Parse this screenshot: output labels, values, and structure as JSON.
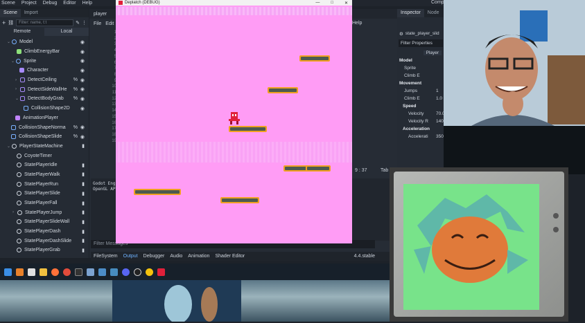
{
  "menu": {
    "items": [
      "Scene",
      "Project",
      "Debug",
      "Editor",
      "Help"
    ]
  },
  "scene_dock": {
    "tabs": [
      "Scene",
      "Import"
    ],
    "filter_placeholder": "Filter: name, t:t",
    "remote_label": "Remote",
    "local_label": "Local",
    "nodes": [
      {
        "label": "Model",
        "color": "#7ab0ff"
      },
      {
        "label": "ClimbEnergyBar",
        "color": "#8de07a"
      },
      {
        "label": "Sprite",
        "color": "#7ab0ff"
      },
      {
        "label": "Character",
        "color": "#a78bfa"
      },
      {
        "label": "DetectCeiling",
        "color": "#a78bfa"
      },
      {
        "label": "DetectSideWallHe",
        "color": "#a78bfa"
      },
      {
        "label": "DetectBodyGrab",
        "color": "#a78bfa"
      },
      {
        "label": "CollisionShape2D",
        "color": "#7ab0ff"
      },
      {
        "label": "AnimationPlayer",
        "color": "#c084fc"
      },
      {
        "label": "CollisionShapeNorma",
        "color": "#7ab0ff"
      },
      {
        "label": "CollisionShapeSlide",
        "color": "#7ab0ff"
      },
      {
        "label": "PlayerStateMachine",
        "color": "#cdd3dc"
      },
      {
        "label": "CoyoteTimer",
        "color": "#cdd3dc"
      },
      {
        "label": "StatePlayerIdle",
        "color": "#cdd3dc"
      },
      {
        "label": "StatePlayerWalk",
        "color": "#cdd3dc"
      },
      {
        "label": "StatePlayerRun",
        "color": "#cdd3dc"
      },
      {
        "label": "StatePlayerSlide",
        "color": "#cdd3dc"
      },
      {
        "label": "StatePlayerFall",
        "color": "#cdd3dc"
      },
      {
        "label": "StatePlayerJump",
        "color": "#cdd3dc"
      },
      {
        "label": "StatePlayerSlideWall",
        "color": "#cdd3dc"
      },
      {
        "label": "StatePlayerDash",
        "color": "#cdd3dc"
      },
      {
        "label": "StatePlayerDashSlide",
        "color": "#cdd3dc"
      },
      {
        "label": "StatePlayerGrab",
        "color": "#cdd3dc"
      }
    ]
  },
  "script_editor": {
    "tab": "player",
    "file_menu": "File",
    "edit_menu": "Edit",
    "help_menu": "Help",
    "line_numbers": [
      "1",
      "2",
      "3",
      "4",
      "5",
      "6",
      "7",
      "8",
      "9",
      "10",
      "11",
      "12",
      "13",
      "14",
      "15",
      "16",
      "17",
      "18",
      "19"
    ],
    "cursor_pos": "9 :  37",
    "tab_label": "Tab",
    "output_lines": [
      "Godot Eng",
      "OpenGL AP"
    ],
    "filter_messages_placeholder": "Filter Messages",
    "bottom_tabs": [
      "FileSystem",
      "Output",
      "Debugger",
      "Audio",
      "Animation",
      "Shader Editor"
    ],
    "version": "4.4.stable"
  },
  "game_window": {
    "title": "Deplatch (DEBUG)"
  },
  "inspector": {
    "tabs": [
      "Inspector",
      "Node"
    ],
    "object_name": "state_player_slid",
    "filter_placeholder": "Filter Properties",
    "class_name": "Player",
    "sections": {
      "model": "Model",
      "movement": "Movement",
      "speed": "Speed",
      "acceleration": "Acceleration"
    },
    "props": {
      "sprite_label": "Sprite",
      "climb_label": "Climb E",
      "jumps_label": "Jumps",
      "jumps_val": "1",
      "climb_e_label": "Climb E",
      "climb_e_val": "1.0",
      "velocity_label": "Velocity",
      "velocity_val": "70.0",
      "velocity_r_label": "Velocity R",
      "velocity_r_val": "140.0",
      "accel_label": "Accelerati",
      "accel_val": "350.0"
    }
  },
  "top_right": {
    "label": "Comp"
  },
  "taskbar": {
    "icons": [
      "windows-icon",
      "store-icon",
      "app-icon",
      "folder-icon",
      "firefox-icon",
      "chrome-icon",
      "terminal-icon",
      "github-icon",
      "network-icon",
      "godot-icon",
      "discord-icon",
      "obs-icon",
      "chrome2-icon",
      "game-icon"
    ]
  },
  "colors": {
    "game_bg": "#ff9cf5",
    "platform_edge": "#f0a020",
    "platform_fill": "#4e5a4e",
    "tv_screen": "#78e38a",
    "player": "#e0203a"
  }
}
